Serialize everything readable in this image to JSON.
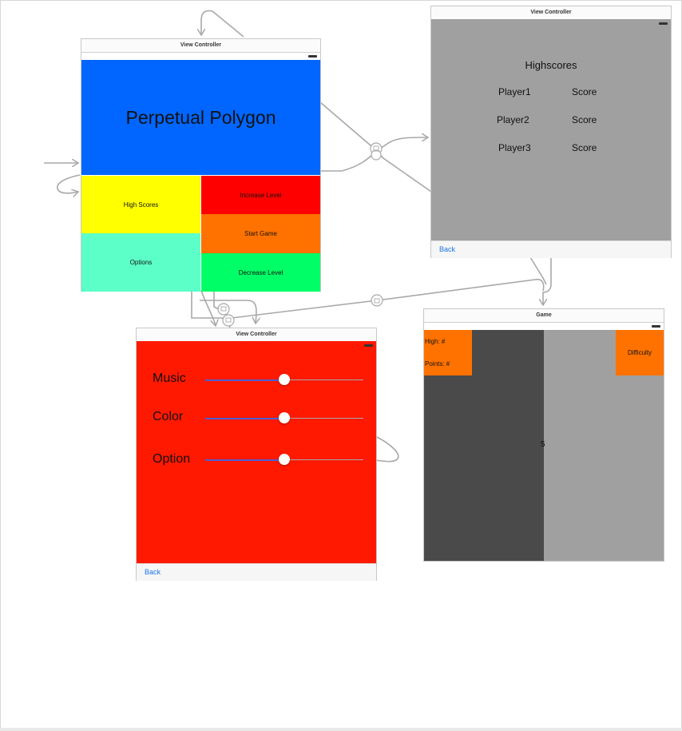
{
  "scenes": {
    "main": {
      "title": "View Controller",
      "app_title": "Perpetual Polygon",
      "buttons": {
        "high_scores": "High Scores",
        "options": "Options",
        "increase_level": "Increase Level",
        "start_game": "Start Game",
        "decrease_level": "Decrease Level"
      }
    },
    "highscores": {
      "title": "View Controller",
      "heading": "Highscores",
      "rows": [
        {
          "player": "Player1",
          "score": "Score"
        },
        {
          "player": "Player2",
          "score": "Score"
        },
        {
          "player": "Player3",
          "score": "Score"
        }
      ],
      "back": "Back"
    },
    "options": {
      "title": "View Controller",
      "sliders": [
        {
          "label": "Music",
          "value": 0.5
        },
        {
          "label": "Color",
          "value": 0.5
        },
        {
          "label": "Option",
          "value": 0.5
        }
      ],
      "back": "Back"
    },
    "game": {
      "title": "Game",
      "high": "High: #",
      "points": "Points: #",
      "difficulty": "Difficulty",
      "center_value": "5"
    }
  },
  "colors": {
    "main_header": "#0066ff",
    "high_scores_btn": "#ffff00",
    "options_btn": "#5cffc8",
    "increase_btn": "#ff0000",
    "start_btn": "#ff7200",
    "decrease_btn": "#00ff66",
    "highscores_bg": "#a0a0a0",
    "options_bg": "#ff1900",
    "game_left": "#4a4a4a",
    "game_right": "#a0a0a0",
    "game_orange": "#ff7200",
    "segue": "#a8a8a8"
  }
}
